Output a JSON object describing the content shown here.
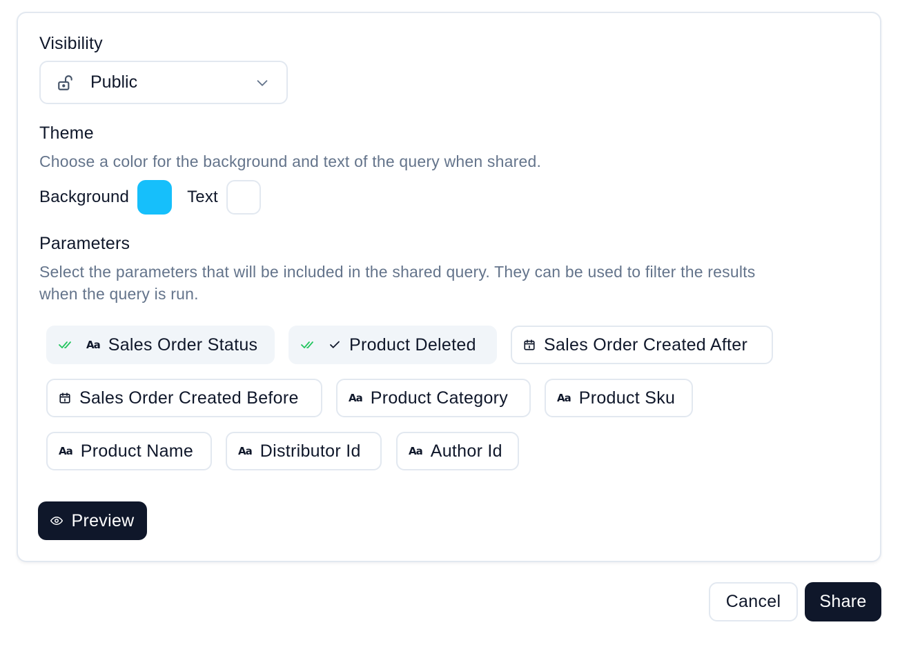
{
  "visibility": {
    "label": "Visibility",
    "selected": "Public",
    "icon": "unlock-icon"
  },
  "theme": {
    "label": "Theme",
    "description": "Choose a color for the background and text of the query when shared.",
    "background_label": "Background",
    "background_color": "#16bffb",
    "text_label": "Text",
    "text_color": "#ffffff"
  },
  "parameters": {
    "label": "Parameters",
    "description_line1": "Select the parameters that will be included in the shared query. They can be used to filter the results",
    "description_line2": "when the query is run.",
    "items": [
      {
        "label": "Sales Order Status",
        "type_icon": "text-type-icon",
        "selected": true
      },
      {
        "label": "Product Deleted",
        "type_icon": "boolean-check-icon",
        "selected": true
      },
      {
        "label": "Sales Order Created After",
        "type_icon": "calendar-icon",
        "selected": false
      },
      {
        "label": "Sales Order Created Before",
        "type_icon": "calendar-icon",
        "selected": false
      },
      {
        "label": "Product Category",
        "type_icon": "text-type-icon",
        "selected": false
      },
      {
        "label": "Product Sku",
        "type_icon": "text-type-icon",
        "selected": false
      },
      {
        "label": "Product Name",
        "type_icon": "text-type-icon",
        "selected": false
      },
      {
        "label": "Distributor Id",
        "type_icon": "text-type-icon",
        "selected": false
      },
      {
        "label": "Author Id",
        "type_icon": "text-type-icon",
        "selected": false
      }
    ]
  },
  "preview_button": {
    "label": "Preview",
    "icon": "eye-icon"
  },
  "footer": {
    "cancel_label": "Cancel",
    "share_label": "Share"
  },
  "colors": {
    "primary_dark": "#0f172a",
    "muted_text": "#64748b",
    "border": "#e2e8f0",
    "selected_chip_bg": "#f1f5f9",
    "check_green": "#22c55e"
  }
}
